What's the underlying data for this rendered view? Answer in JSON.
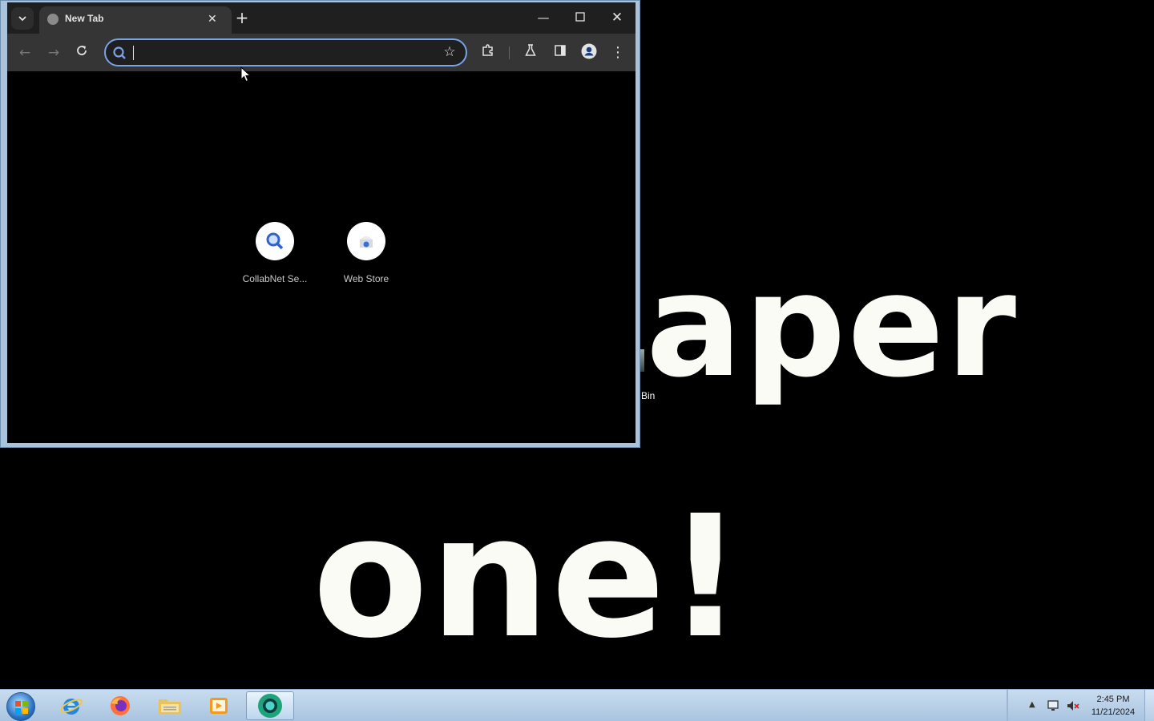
{
  "wallpaper": {
    "line1": "aper",
    "line2": "one!"
  },
  "desktop": {
    "icon_label": "Bin"
  },
  "browser": {
    "tab": {
      "title": "New Tab"
    },
    "omnibox": {
      "value": "",
      "placeholder": ""
    },
    "shortcuts": [
      {
        "label": "CollabNet Se...",
        "icon": "magnifier-icon"
      },
      {
        "label": "Web Store",
        "icon": "web-store-icon"
      }
    ],
    "colors": {
      "accent": "#7aa3e6",
      "toolbar": "#353535",
      "tabstrip": "#1f1f1f"
    }
  },
  "taskbar": {
    "apps": [
      "internet-explorer-icon",
      "firefox-icon",
      "file-explorer-icon",
      "media-player-icon",
      "chrome-icon"
    ],
    "clock": {
      "time": "2:45 PM",
      "date": "11/21/2024"
    }
  }
}
